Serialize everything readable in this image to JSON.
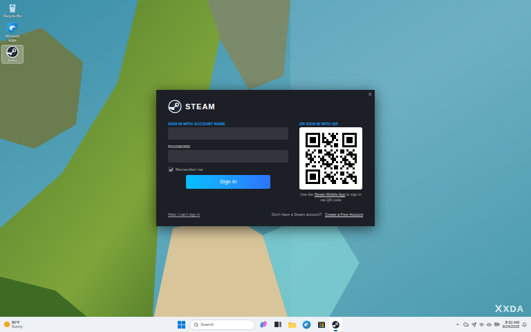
{
  "desktop": {
    "icons": [
      {
        "label": "Recycle Bin",
        "selected": false
      },
      {
        "label": "Microsoft Edge",
        "selected": false
      },
      {
        "label": "Steam",
        "selected": true
      }
    ]
  },
  "dialog": {
    "close": "×",
    "logo": "STEAM",
    "account_label": "SIGN IN WITH ACCOUNT NAME",
    "password_label": "PASSWORD",
    "remember": {
      "label": "Remember me",
      "checked": true
    },
    "sign_in": "Sign in",
    "help": "Help, I can't sign in",
    "qr_title": "OR SIGN IN WITH QR",
    "qr_text_before": "Use the ",
    "qr_link": "Steam Mobile App",
    "qr_text_after": " to sign in via QR code",
    "no_account": "Don't have a Steam account?",
    "create": "Create a Free Account"
  },
  "taskbar": {
    "weather": {
      "temp": "80°F",
      "condition": "Sunny"
    },
    "search": {
      "placeholder": "Search"
    },
    "apps": [
      {
        "kind": "copilot",
        "active": false
      },
      {
        "kind": "taskview",
        "active": false
      },
      {
        "kind": "folder",
        "active": false
      },
      {
        "kind": "edge",
        "active": false
      },
      {
        "kind": "store",
        "active": false
      },
      {
        "kind": "steam",
        "active": true
      }
    ],
    "time": "8:52 AM",
    "date": "9/24/2025"
  },
  "watermark": "XDA"
}
